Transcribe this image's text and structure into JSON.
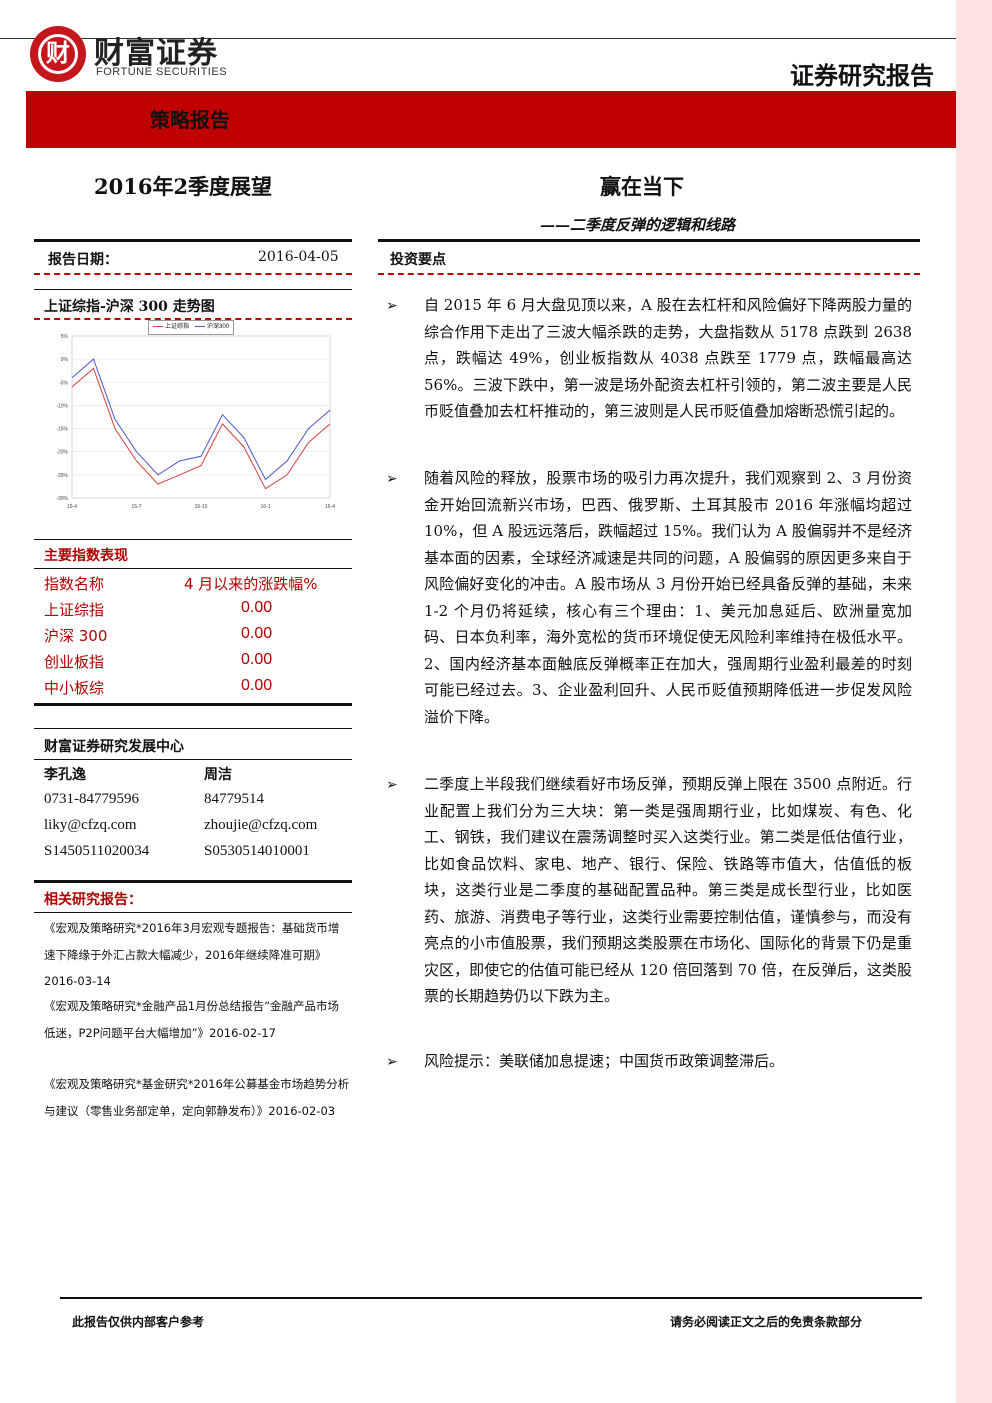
{
  "brand": {
    "logo_glyph": "财",
    "name_cn": "财富证券",
    "name_en": "FORTUNE SECURITIES",
    "report_type": "证券研究报告",
    "accent_color": "#c00000"
  },
  "band": {
    "label": "策略报告"
  },
  "header": {
    "outlook": "2016年2季度展望",
    "title": "赢在当下",
    "subtitle": "——二季度反弹的逻辑和线路"
  },
  "report_date": {
    "label": "报告日期：",
    "value": "2016-04-05"
  },
  "invest_points": {
    "heading": "投资要点",
    "bullet_symbol": "➢",
    "items": [
      "自 2015 年 6 月大盘见顶以来，A 股在去杠杆和风险偏好下降两股力量的综合作用下走出了三波大幅杀跌的走势，大盘指数从 5178 点跌到 2638 点，跌幅达 49%，创业板指数从 4038 点跌至 1779 点，跌幅最高达 56%。三波下跌中，第一波是场外配资去杠杆引领的，第二波主要是人民币贬值叠加去杠杆推动的，第三波则是人民币贬值叠加熔断恐慌引起的。",
      "随着风险的释放，股票市场的吸引力再次提升，我们观察到 2、3 月份资金开始回流新兴市场，巴西、俄罗斯、土耳其股市 2016 年涨幅均超过 10%，但 A 股远远落后，跌幅超过 15%。我们认为 A 股偏弱并不是经济基本面的因素，全球经济减速是共同的问题，A 股偏弱的原因更多来自于风险偏好变化的冲击。A 股市场从 3 月份开始已经具备反弹的基础，未来 1-2 个月仍将延续，核心有三个理由：1、美元加息延后、欧洲量宽加码、日本负利率，海外宽松的货币环境促使无风险利率维持在极低水平。2、国内经济基本面触底反弹概率正在加大，强周期行业盈利最差的时刻可能已经过去。3、企业盈利回升、人民币贬值预期降低进一步促发风险溢价下降。",
      "二季度上半段我们继续看好市场反弹，预期反弹上限在 3500 点附近。行业配置上我们分为三大块：第一类是强周期行业，比如煤炭、有色、化工、钢铁，我们建议在震荡调整时买入这类行业。第二类是低估值行业，比如食品饮料、家电、地产、银行、保险、铁路等市值大，估值低的板块，这类行业是二季度的基础配置品种。第三类是成长型行业，比如医药、旅游、消费电子等行业，这类行业需要控制估值，谨慎参与，而没有亮点的小市值股票，我们预期这类股票在市场化、国际化的背景下仍是重灾区，即使它的估值可能已经从 120 倍回落到 70 倍，在反弹后，这类股票的长期趋势仍以下跌为主。",
      "风险提示：美联储加息提速；中国货币政策调整滞后。"
    ]
  },
  "chart": {
    "title": "上证综指-沪深 300 走势图",
    "legend": [
      "上证综指",
      "沪深300"
    ],
    "y_ticks": [
      "5%",
      "0%",
      "-5%",
      "-10%",
      "-15%",
      "-20%",
      "-25%",
      "-30%"
    ],
    "x_ticks": [
      "15-4",
      "15-7",
      "15-10",
      "16-1",
      "16-4"
    ]
  },
  "chart_data": {
    "type": "line",
    "ylim": [
      -30,
      5
    ],
    "grid": true,
    "legend_placement": "top",
    "x": [
      "15-4",
      "15-5",
      "15-6",
      "15-7",
      "15-8",
      "15-9",
      "15-10",
      "15-11",
      "15-12",
      "16-1",
      "16-2",
      "16-3",
      "16-4"
    ],
    "series": [
      {
        "name": "上证综指",
        "color": "#d94040",
        "values": [
          -6,
          -2,
          -15,
          -22,
          -27,
          -25,
          -23,
          -14,
          -19,
          -28,
          -25,
          -18,
          -14
        ]
      },
      {
        "name": "沪深300",
        "color": "#4a55c8",
        "values": [
          -4,
          0,
          -13,
          -20,
          -25,
          -22,
          -21,
          -12,
          -17,
          -26,
          -22,
          -15,
          -11
        ]
      }
    ]
  },
  "indices": {
    "heading": "主要指数表现",
    "col_name": "指数名称",
    "col_change": "4 月以来的涨跌幅%",
    "rows": [
      {
        "name": "上证综指",
        "value": "0.00"
      },
      {
        "name": "沪深 300",
        "value": "0.00"
      },
      {
        "name": "创业板指",
        "value": "0.00"
      },
      {
        "name": "中小板综",
        "value": "0.00"
      }
    ]
  },
  "research_center": {
    "title": "财富证券研究发展中心",
    "analysts": [
      {
        "name": "李孔逸",
        "phone": "0731-84779596",
        "email": "liky@cfzq.com",
        "cert": "S1450511020034"
      },
      {
        "name": "周洁",
        "phone": "84779514",
        "email": "zhoujie@cfzq.com",
        "cert": "S0530514010001"
      }
    ]
  },
  "related": {
    "heading": "相关研究报告：",
    "items": [
      "《宏观及策略研究*2016年3月宏观专题报告：基础货币增速下降缘于外汇占款大幅减少，2016年继续降准可期》2016-03-14",
      "《宏观及策略研究*金融产品1月份总结报告“金融产品市场低迷，P2P问题平台大幅增加”》2016-02-17",
      "《宏观及策略研究*基金研究*2016年公募基金市场趋势分析与建议（零售业务部定单，定向郭静发布）》2016-02-03"
    ]
  },
  "footer": {
    "left": "此报告仅供内部客户参考",
    "right": "请务必阅读正文之后的免责条款部分"
  }
}
